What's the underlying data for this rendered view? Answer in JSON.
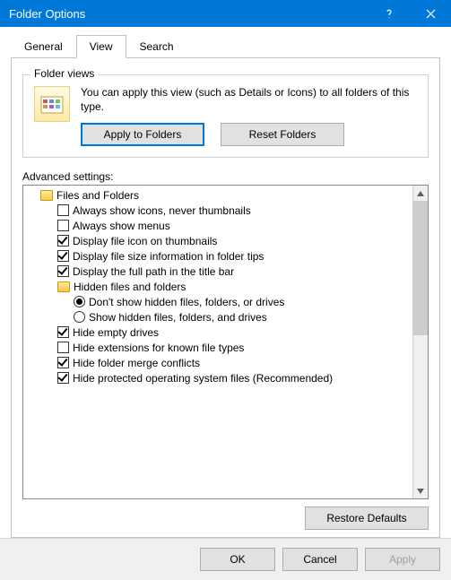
{
  "window": {
    "title": "Folder Options"
  },
  "tabs": {
    "general": "General",
    "view": "View",
    "search": "Search"
  },
  "folderviews": {
    "title": "Folder views",
    "desc": "You can apply this view (such as Details or Icons) to all folders of this type.",
    "apply": "Apply to Folders",
    "reset": "Reset Folders"
  },
  "advanced": {
    "label": "Advanced settings:",
    "root": "Files and Folders",
    "items": [
      {
        "label": "Always show icons, never thumbnails",
        "checked": false
      },
      {
        "label": "Always show menus",
        "checked": false
      },
      {
        "label": "Display file icon on thumbnails",
        "checked": true
      },
      {
        "label": "Display file size information in folder tips",
        "checked": true
      },
      {
        "label": "Display the full path in the title bar",
        "checked": true
      }
    ],
    "hidden": {
      "label": "Hidden files and folders",
      "options": [
        {
          "label": "Don't show hidden files, folders, or drives",
          "checked": true
        },
        {
          "label": "Show hidden files, folders, and drives",
          "checked": false
        }
      ]
    },
    "items2": [
      {
        "label": "Hide empty drives",
        "checked": true
      },
      {
        "label": "Hide extensions for known file types",
        "checked": false
      },
      {
        "label": "Hide folder merge conflicts",
        "checked": true
      },
      {
        "label": "Hide protected operating system files (Recommended)",
        "checked": true
      }
    ],
    "restore": "Restore Defaults"
  },
  "buttons": {
    "ok": "OK",
    "cancel": "Cancel",
    "apply": "Apply"
  }
}
